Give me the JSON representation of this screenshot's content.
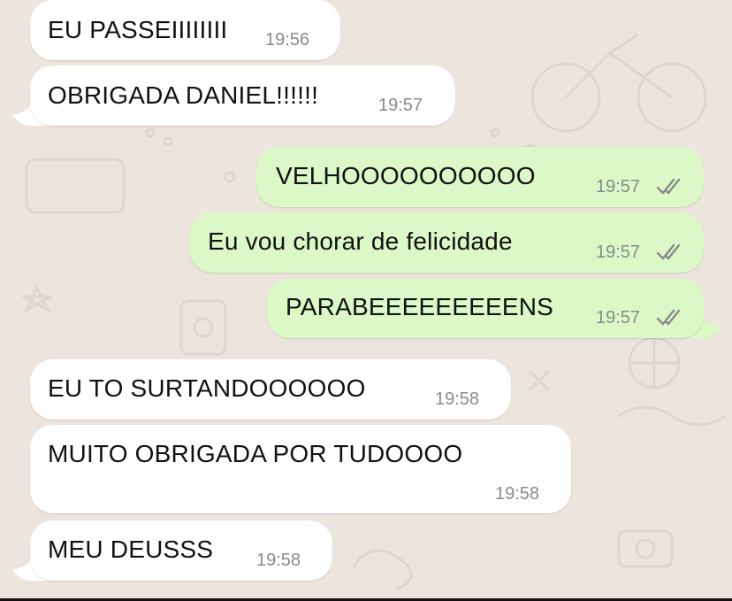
{
  "colors": {
    "chat_background": "#ece5dd",
    "incoming_bubble": "#ffffff",
    "outgoing_bubble": "#dcf8c6",
    "timestamp": "#8a8a8a",
    "read_receipt": "#8a8a8a"
  },
  "messages": [
    {
      "direction": "incoming",
      "text": "EU PASSEIIIIIIII",
      "time": "19:56"
    },
    {
      "direction": "incoming",
      "text": "OBRIGADA DANIEL!!!!!!",
      "time": "19:57"
    },
    {
      "direction": "outgoing",
      "text": "VELHOOOOOOOOOO",
      "time": "19:57",
      "status_icon": "double-check-icon"
    },
    {
      "direction": "outgoing",
      "text": "Eu vou chorar de felicidade",
      "time": "19:57",
      "status_icon": "double-check-icon"
    },
    {
      "direction": "outgoing",
      "text": "PARABEEEEEEEEENS",
      "time": "19:57",
      "status_icon": "double-check-icon"
    },
    {
      "direction": "incoming",
      "text": "EU TO SURTANDOOOOOO",
      "time": "19:58"
    },
    {
      "direction": "incoming",
      "text": "MUITO OBRIGADA POR TUDOOOO",
      "time": "19:58"
    },
    {
      "direction": "incoming",
      "text": "MEU DEUSSS",
      "time": "19:58"
    }
  ]
}
